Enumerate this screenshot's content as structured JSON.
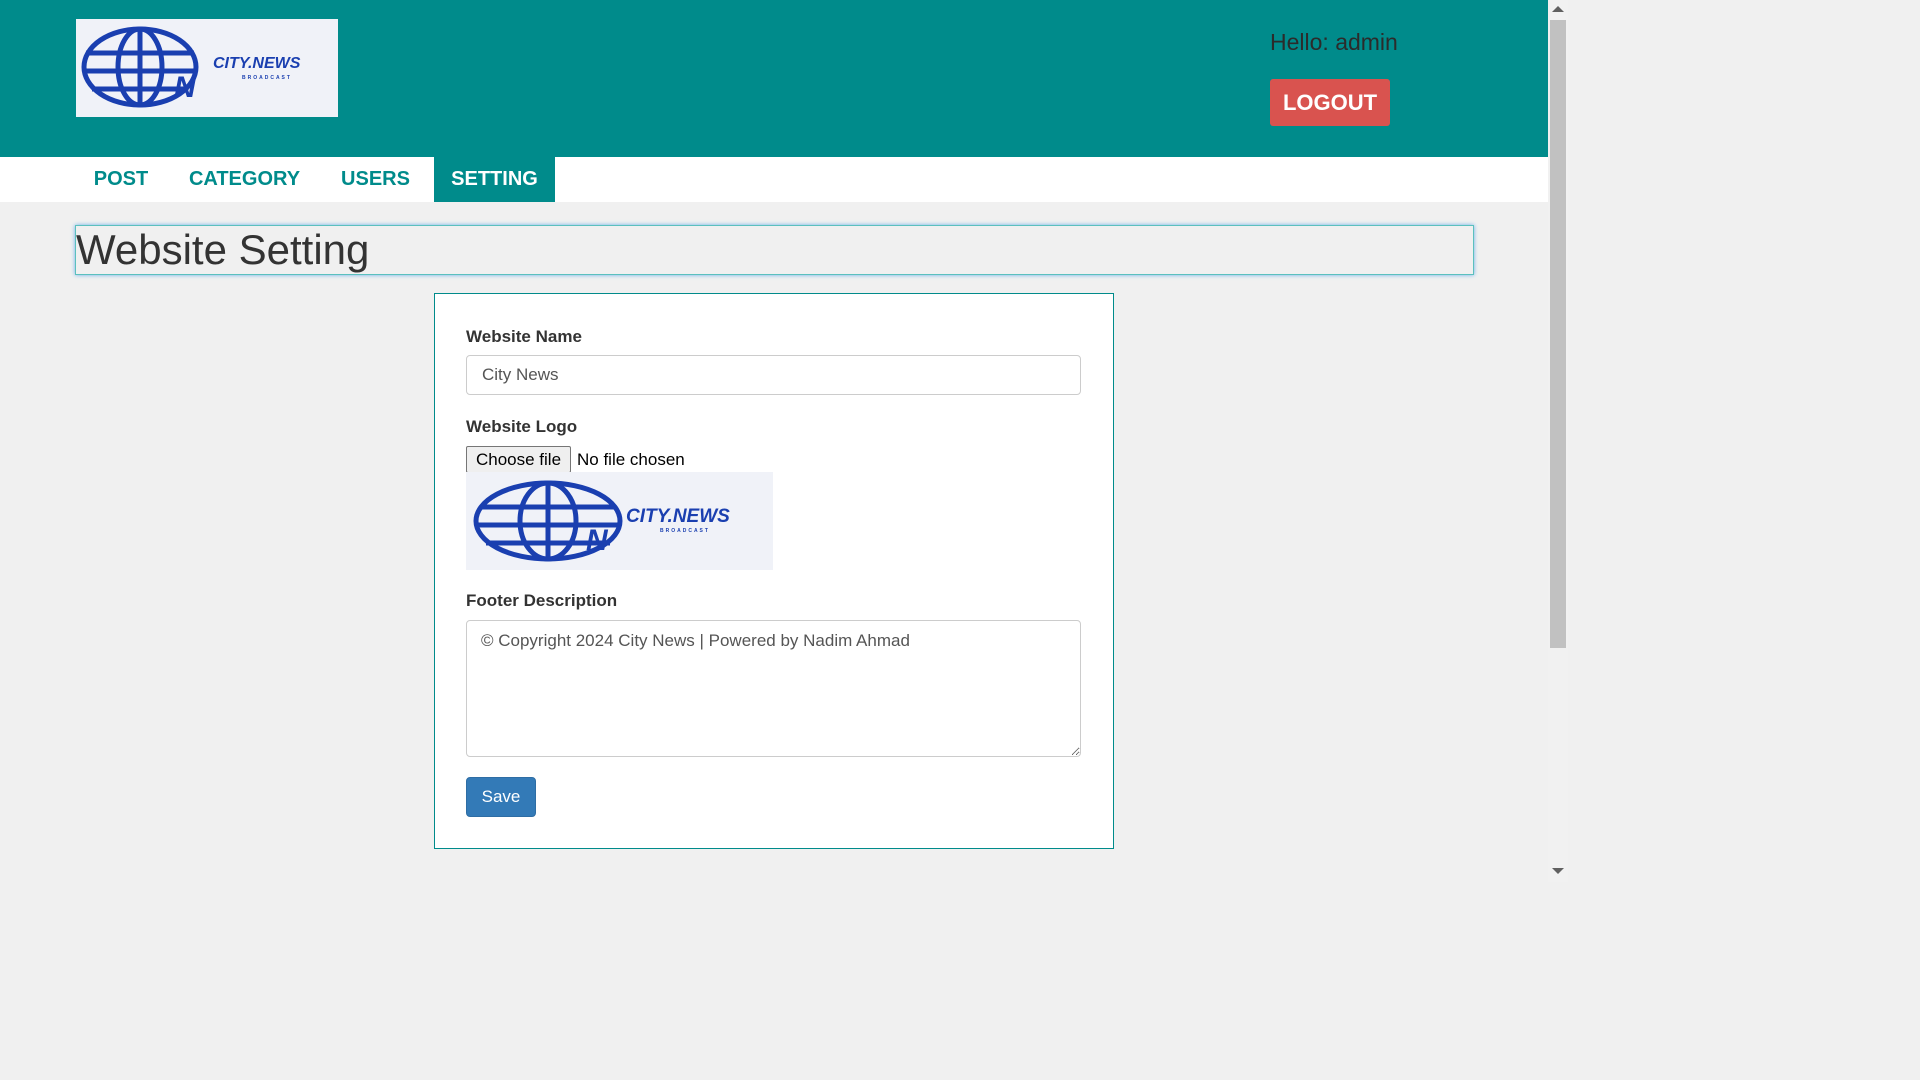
{
  "header": {
    "logo": {
      "text": "CITY.NEWS",
      "subtext": "BROADCAST",
      "icon": "globe-icon"
    },
    "greeting": "Hello: admin",
    "logout_label": "LOGOUT"
  },
  "nav": {
    "items": [
      {
        "label": "POST"
      },
      {
        "label": "CATEGORY"
      },
      {
        "label": "USERS"
      },
      {
        "label": "SETTING"
      }
    ],
    "active": "SETTING"
  },
  "page": {
    "title": "Website Setting"
  },
  "form": {
    "website_name_label": "Website Name",
    "website_name_value": "City News",
    "website_logo_label": "Website Logo",
    "choose_file_label": "Choose file",
    "file_status": "No file chosen",
    "logo_preview": {
      "text": "CITY.NEWS",
      "subtext": "BROADCAST"
    },
    "footer_label": "Footer Description",
    "footer_value": "© Copyright 2024 City News | Powered by Nadim Ahmad",
    "save_label": "Save"
  },
  "colors": {
    "header_bg": "#008b8b",
    "logout_bg": "#d9534f",
    "save_bg": "#337ab7",
    "logo_blue": "#1a3fb0"
  }
}
